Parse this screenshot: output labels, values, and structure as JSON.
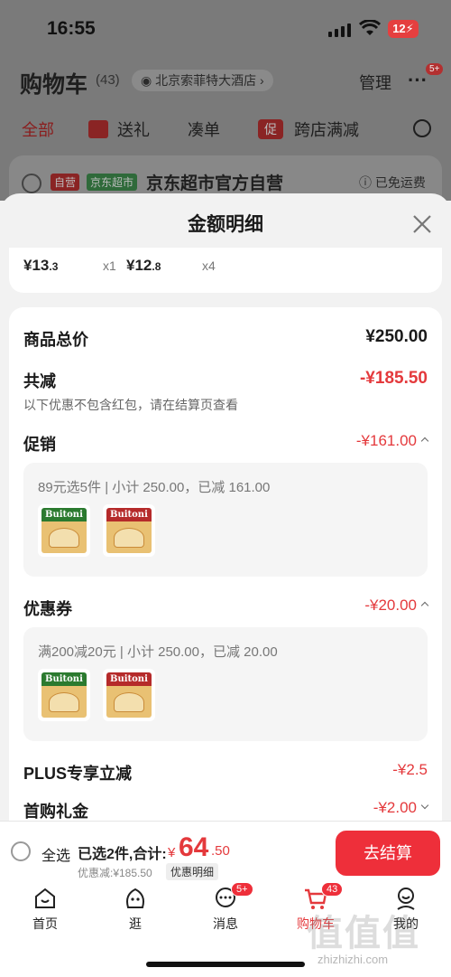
{
  "status": {
    "time": "16:55",
    "battery": "12"
  },
  "bg": {
    "title": "购物车",
    "count": "(43)",
    "location": "北京索菲特大酒店",
    "manage": "管理",
    "more_badge": "5+",
    "tabs": [
      "全部",
      "送礼",
      "凑单",
      "跨店满减"
    ],
    "promo_tag": "促",
    "store": {
      "tag_self": "自营",
      "tag_market": "京东超市",
      "name": "京东超市官方自营",
      "shipping": "已免运费"
    }
  },
  "sheet": {
    "title": "金额明细",
    "items": [
      {
        "price_int": "¥13",
        "price_dec": ".3",
        "qty": "x1"
      },
      {
        "price_int": "¥12",
        "price_dec": ".8",
        "qty": "x4"
      }
    ],
    "total_label": "商品总价",
    "total_value": "¥250.00",
    "reduce_label": "共减",
    "reduce_value": "-¥185.50",
    "reduce_note": "以下优惠不包含红包，请在结算页查看",
    "promo": {
      "label": "促销",
      "value": "-¥161.00",
      "desc": "89元选5件 | 小计 250.00，已减 161.00"
    },
    "coupon": {
      "label": "优惠券",
      "value": "-¥20.00",
      "desc": "满200减20元 | 小计 250.00，已减 20.00"
    },
    "plus": {
      "label": "PLUS专享立减",
      "value": "-¥2.5"
    },
    "first": {
      "label": "首购礼金",
      "value": "-¥2.00"
    },
    "thumb_brand": "Buitoni"
  },
  "checkout": {
    "select_all": "全选",
    "selected": "已选2件,合计:",
    "currency": "¥",
    "total_int": "64",
    "total_dec": ".50",
    "discount": "优惠减:¥185.50",
    "detail": "优惠明细",
    "button": "去结算"
  },
  "tabbar": {
    "items": [
      {
        "label": "首页"
      },
      {
        "label": "逛"
      },
      {
        "label": "消息",
        "badge": "5+"
      },
      {
        "label": "购物车",
        "badge": "43"
      },
      {
        "label": "我的"
      }
    ]
  },
  "watermark": {
    "main": "值值值",
    "url": "zhizhizhi.com"
  },
  "colors": {
    "accent": "#e4393c",
    "button": "#ee2f3a"
  }
}
